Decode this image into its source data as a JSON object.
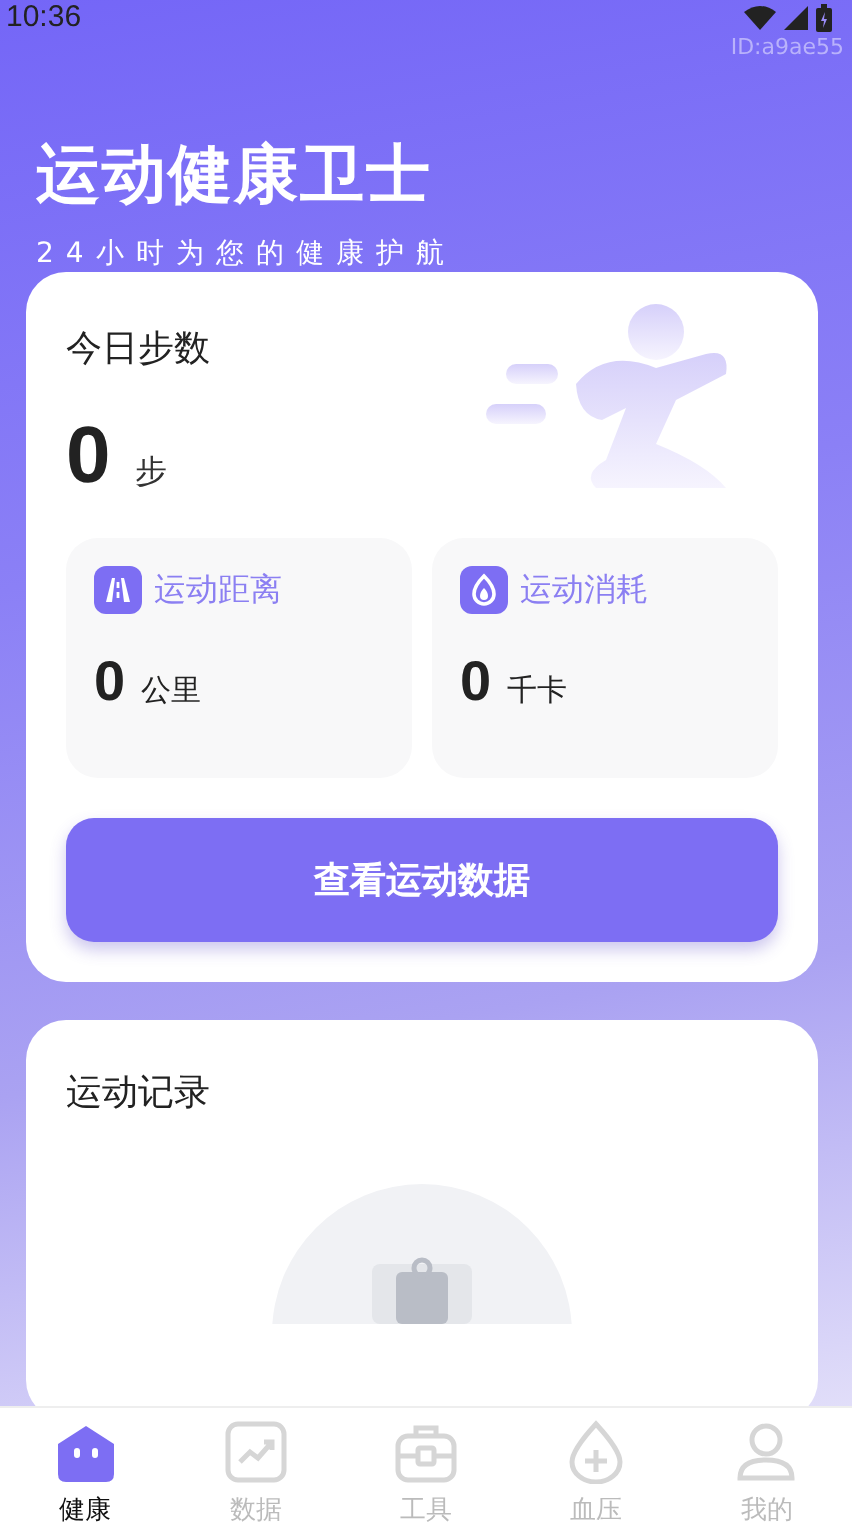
{
  "status_bar": {
    "time": "10:36"
  },
  "app_id": "ID:a9ae55",
  "header": {
    "title": "运动健康卫士",
    "subtitle": "24小时为您的健康护航"
  },
  "steps_card": {
    "title": "今日步数",
    "value": "0",
    "unit": "步",
    "stats": [
      {
        "kind": "distance",
        "label": "运动距离",
        "value": "0",
        "unit": "公里"
      },
      {
        "kind": "calories",
        "label": "运动消耗",
        "value": "0",
        "unit": "千卡"
      }
    ],
    "button": "查看运动数据"
  },
  "records_card": {
    "title": "运动记录"
  },
  "tab_bar": [
    {
      "label": "健康",
      "selected": true
    },
    {
      "label": "数据",
      "selected": false
    },
    {
      "label": "工具",
      "selected": false
    },
    {
      "label": "血压",
      "selected": false
    },
    {
      "label": "我的",
      "selected": false
    }
  ]
}
